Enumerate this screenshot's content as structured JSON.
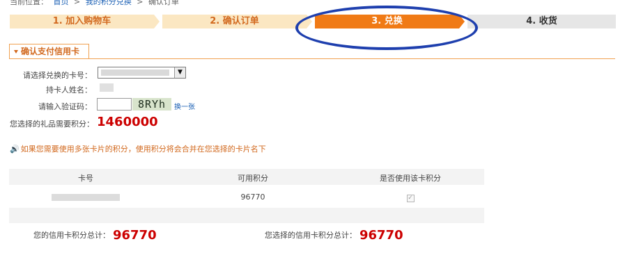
{
  "breadcrumb": {
    "prefix": "当前位置：",
    "home": "首页",
    "sep1": ">",
    "section": "我的积分兑换",
    "sep2": ">",
    "current": "确认订单"
  },
  "steps": [
    {
      "label": "1. 加入购物车",
      "state": "done"
    },
    {
      "label": "2. 确认订单",
      "state": "done"
    },
    {
      "label": "3. 兑换",
      "state": "active"
    },
    {
      "label": "4. 收货",
      "state": "todo"
    }
  ],
  "tab": {
    "label": "确认支付信用卡"
  },
  "form": {
    "card_label": "请选择兑换的卡号：",
    "holder_label": "持卡人姓名：",
    "captcha_label": "请输入验证码：",
    "captcha_text": "8RYh",
    "captcha_refresh": "换一张",
    "points_label": "您选择的礼品需要积分：",
    "points_value": "1460000"
  },
  "notice": {
    "text": "如果您需要使用多张卡片的积分，使用积分将会合并在您选择的卡片名下"
  },
  "table": {
    "headers": [
      "卡号",
      "可用积分",
      "是否使用该卡积分"
    ],
    "rows": [
      {
        "points": "96770",
        "checked": true
      }
    ]
  },
  "totals": {
    "credit_label": "您的信用卡积分总计：",
    "credit_value": "96770",
    "selected_label": "您选择的信用卡积分总计：",
    "selected_value": "96770"
  },
  "colors": {
    "accent": "#f07a15",
    "highlight": "#cc0000",
    "link": "#1a5fb4",
    "annotation": "#1e3fae"
  }
}
